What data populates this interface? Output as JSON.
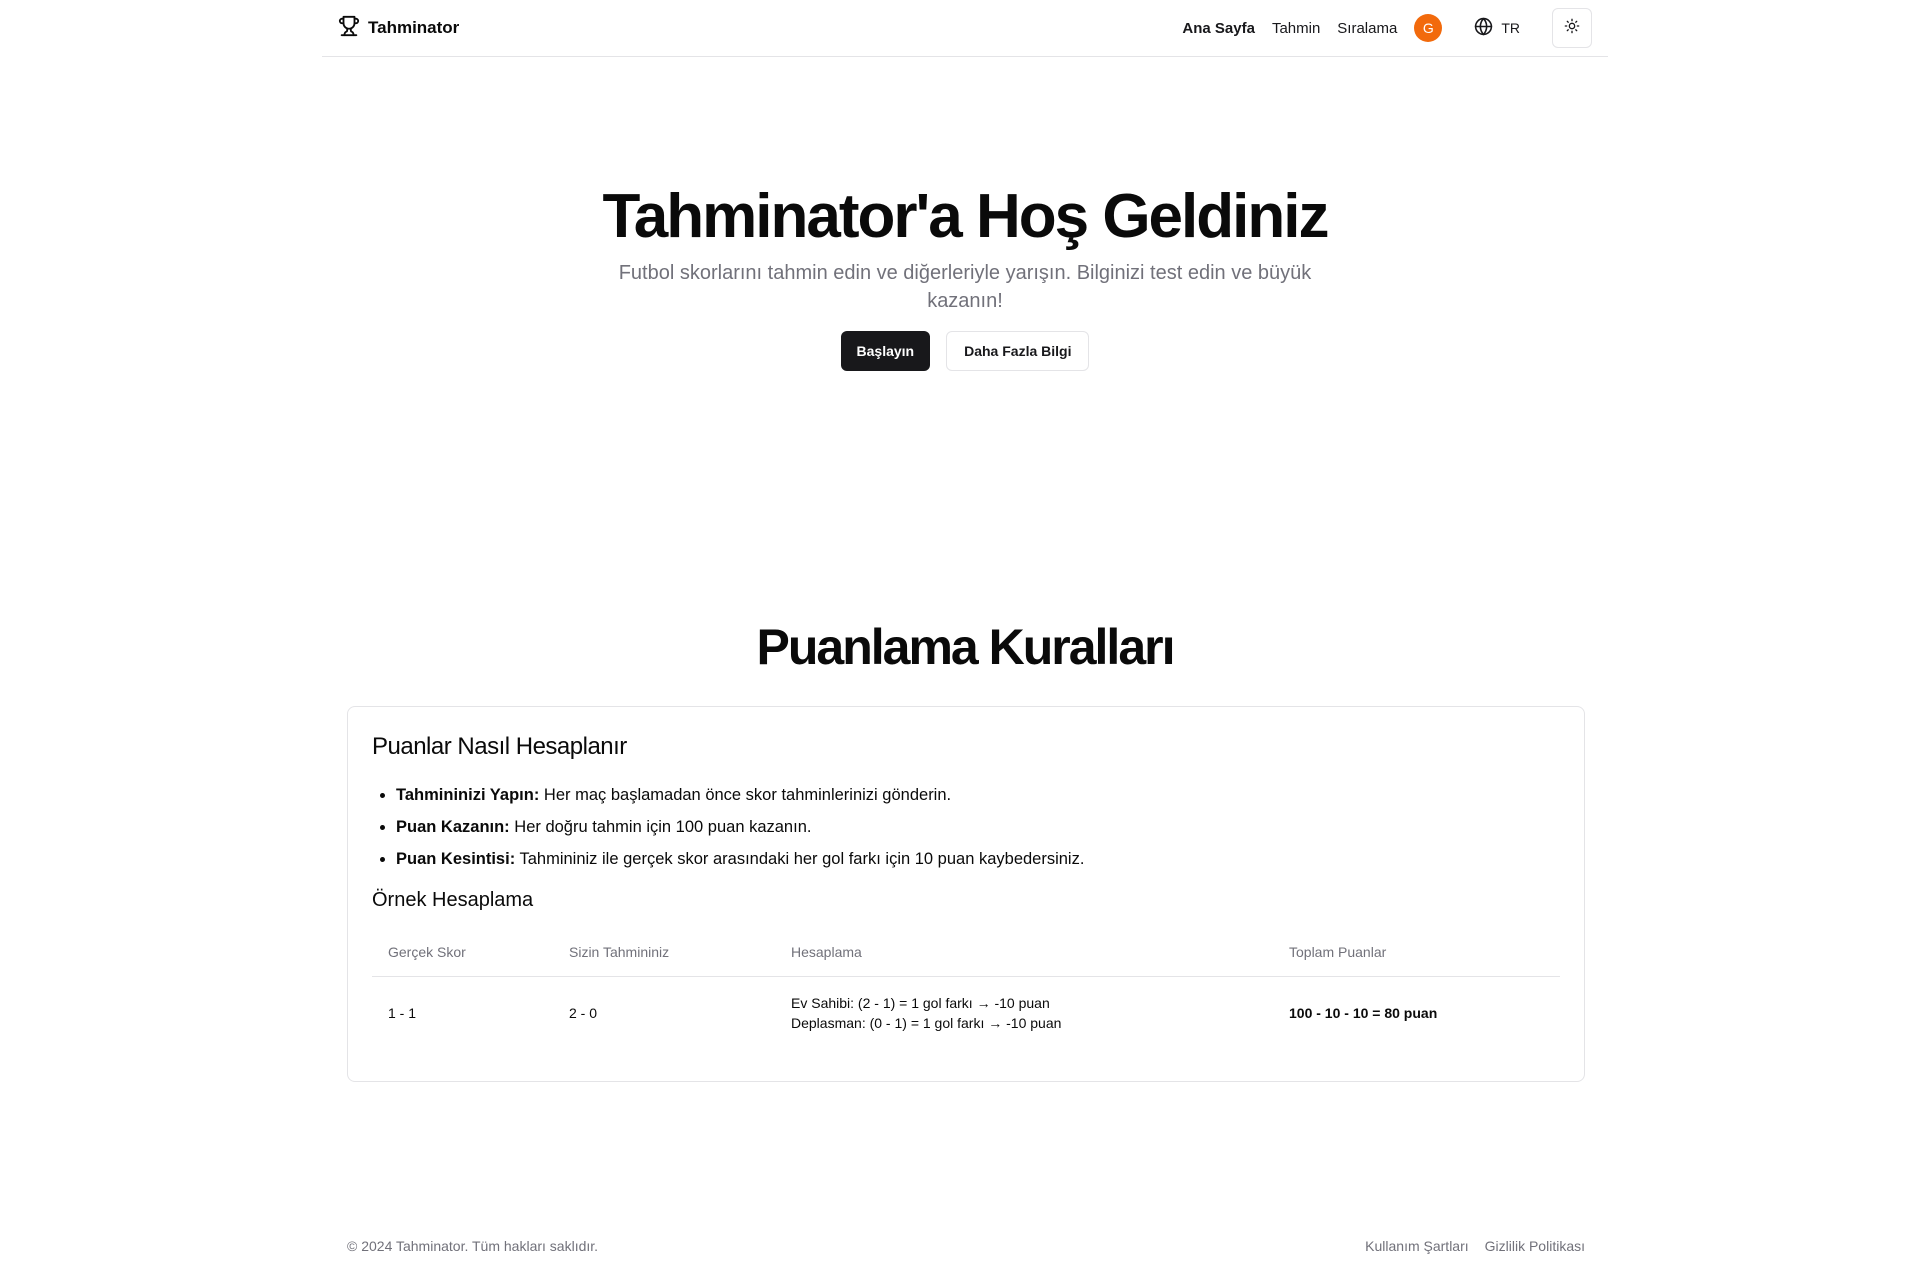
{
  "header": {
    "brand": "Tahminator",
    "nav": {
      "home": "Ana Sayfa",
      "predict": "Tahmin",
      "leaderboard": "Sıralama"
    },
    "avatar_initial": "G",
    "language": "TR"
  },
  "hero": {
    "title": "Tahminator'a Hoş Geldiniz",
    "subtitle": "Futbol skorlarını tahmin edin ve diğerleriyle yarışın. Bilginizi test edin ve büyük kazanın!",
    "primary_button": "Başlayın",
    "secondary_button": "Daha Fazla Bilgi"
  },
  "rules": {
    "title": "Puanlama Kuralları",
    "card_title": "Puanlar Nasıl Hesaplanır",
    "items": [
      {
        "label": "Tahmininizi Yapın:",
        "text": " Her maç başlamadan önce skor tahminlerinizi gönderin."
      },
      {
        "label": "Puan Kazanın:",
        "text": " Her doğru tahmin için 100 puan kazanın."
      },
      {
        "label": "Puan Kesintisi:",
        "text": " Tahmininiz ile gerçek skor arasındaki her gol farkı için 10 puan kaybedersiniz."
      }
    ],
    "example_title": "Örnek Hesaplama",
    "table": {
      "headers": [
        "Gerçek Skor",
        "Sizin Tahmininiz",
        "Hesaplama",
        "Toplam Puanlar"
      ],
      "row": {
        "actual": "1 - 1",
        "prediction": "2 - 0",
        "calc_line1": "Ev Sahibi: (2 - 1) = 1 gol farkı → -10 puan",
        "calc_line2": "Deplasman: (0 - 1) = 1 gol farkı → -10 puan",
        "total": "100 - 10 - 10 = 80 puan"
      }
    }
  },
  "footer": {
    "copyright": "© 2024 Tahminator. Tüm hakları saklıdır.",
    "terms": "Kullanım Şartları",
    "privacy": "Gizlilik Politikası"
  },
  "colors": {
    "avatar": "#f26a0c",
    "primary": "#18181b",
    "muted": "#71717a",
    "border": "#e4e4e7"
  },
  "icons": {
    "brand": "trophy-icon",
    "language": "globe-icon",
    "theme": "sun-icon"
  }
}
